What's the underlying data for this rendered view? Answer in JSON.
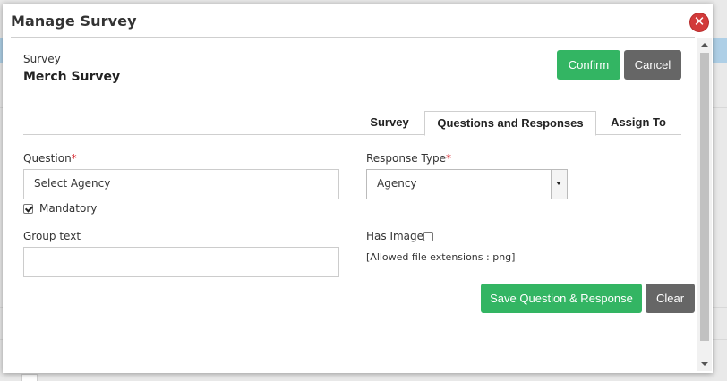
{
  "modal": {
    "title": "Manage Survey",
    "close_symbol": "✕"
  },
  "survey": {
    "caption": "Survey",
    "name": "Merch Survey"
  },
  "actions": {
    "confirm_label": "Confirm",
    "cancel_label": "Cancel"
  },
  "tabs": [
    {
      "label": "Survey",
      "active": false
    },
    {
      "label": "Questions and Responses",
      "active": true
    },
    {
      "label": "Assign To",
      "active": false
    }
  ],
  "form": {
    "question_label": "Question",
    "required_mark": "*",
    "question_value": "Select Agency",
    "mandatory_label": "Mandatory",
    "mandatory_checked": true,
    "group_text_label": "Group text",
    "group_text_value": "",
    "response_type_label": "Response Type",
    "response_type_value": "Agency",
    "has_image_label": "Has Image",
    "has_image_checked": false,
    "allowed_extensions": "[Allowed file extensions : png]"
  },
  "footer_actions": {
    "save_label": "Save Question & Response",
    "clear_label": "Clear"
  },
  "colors": {
    "primary_green": "#33b563",
    "secondary_gray": "#666666",
    "close_red": "#d23a3a",
    "required_red": "#d9262e"
  }
}
